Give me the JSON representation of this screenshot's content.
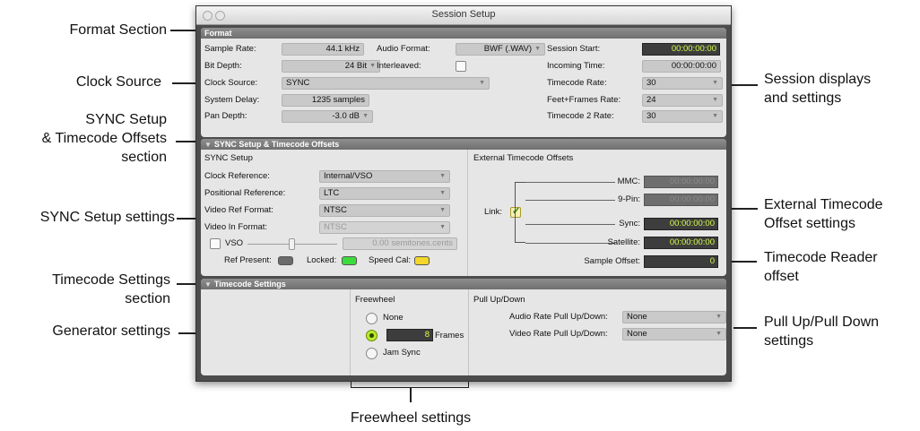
{
  "window": {
    "title": "Session Setup"
  },
  "format": {
    "header": "Format",
    "sample_rate_label": "Sample Rate:",
    "sample_rate": "44.1 kHz",
    "bit_depth_label": "Bit Depth:",
    "bit_depth": "24 Bit",
    "clock_source_label": "Clock Source:",
    "clock_source": "SYNC",
    "system_delay_label": "System Delay:",
    "system_delay": "1235 samples",
    "pan_depth_label": "Pan Depth:",
    "pan_depth": "-3.0 dB",
    "audio_format_label": "Audio Format:",
    "audio_format": "BWF (.WAV)",
    "interleaved_label": "Interleaved:",
    "interleaved": false,
    "session_start_label": "Session Start:",
    "session_start": "00:00:00:00",
    "incoming_time_label": "Incoming Time:",
    "incoming_time": "00:00:00:00",
    "timecode_rate_label": "Timecode Rate:",
    "timecode_rate": "30",
    "feet_frames_label": "Feet+Frames Rate:",
    "feet_frames": "24",
    "timecode2_label": "Timecode 2 Rate:",
    "timecode2": "30"
  },
  "sync": {
    "header": "SYNC Setup & Timecode Offsets",
    "setup_title": "SYNC Setup",
    "clock_ref_label": "Clock Reference:",
    "clock_ref": "Internal/VSO",
    "pos_ref_label": "Positional Reference:",
    "pos_ref": "LTC",
    "video_ref_label": "Video Ref Format:",
    "video_ref": "NTSC",
    "video_in_label": "Video In Format:",
    "video_in": "NTSC",
    "vso_label": "VSO",
    "vso_value": "0.00  semitones.cents",
    "ref_present_label": "Ref Present:",
    "locked_label": "Locked:",
    "speed_cal_label": "Speed Cal:",
    "ext_title": "External Timecode Offsets",
    "link_label": "Link:",
    "mmc_label": "MMC:",
    "mmc": "00:00:00:00",
    "ninepin_label": "9-Pin:",
    "ninepin": "00:00:00:00",
    "sync_label": "Sync:",
    "sync_value": "00:00:00:00",
    "satellite_label": "Satellite:",
    "satellite": "00:00:00:00",
    "sample_offset_label": "Sample Offset:",
    "sample_offset": "0"
  },
  "timecode": {
    "header": "Timecode Settings",
    "freewheel_title": "Freewheel",
    "none_label": "None",
    "frames_value": "8",
    "frames_label": "Frames",
    "jam_label": "Jam Sync",
    "pull_title": "Pull Up/Down",
    "audio_pull_label": "Audio Rate Pull Up/Down:",
    "audio_pull": "None",
    "video_pull_label": "Video Rate Pull Up/Down:",
    "video_pull": "None"
  },
  "callouts": {
    "format_section": "Format Section",
    "clock_source": "Clock Source",
    "sync_section_1": "SYNC Setup",
    "sync_section_2": "& Timecode Offsets",
    "sync_section_3": "section",
    "sync_settings": "SYNC Setup settings",
    "tc_section_1": "Timecode Settings",
    "tc_section_2": "section",
    "generator": "Generator settings",
    "session_1": "Session displays",
    "session_2": "and settings",
    "ext_1": "External Timecode",
    "ext_2": "Offset settings",
    "reader_1": "Timecode Reader",
    "reader_2": "offset",
    "pull_1": "Pull Up/Pull Down",
    "pull_2": "settings",
    "freewheel": "Freewheel settings"
  },
  "colors": {
    "timecode_text": "#d7ff48",
    "ref_led": "#6b6b6b",
    "locked_led": "#3ddc3d",
    "speed_led": "#f3d62c",
    "panel": "#e6e6e6"
  }
}
